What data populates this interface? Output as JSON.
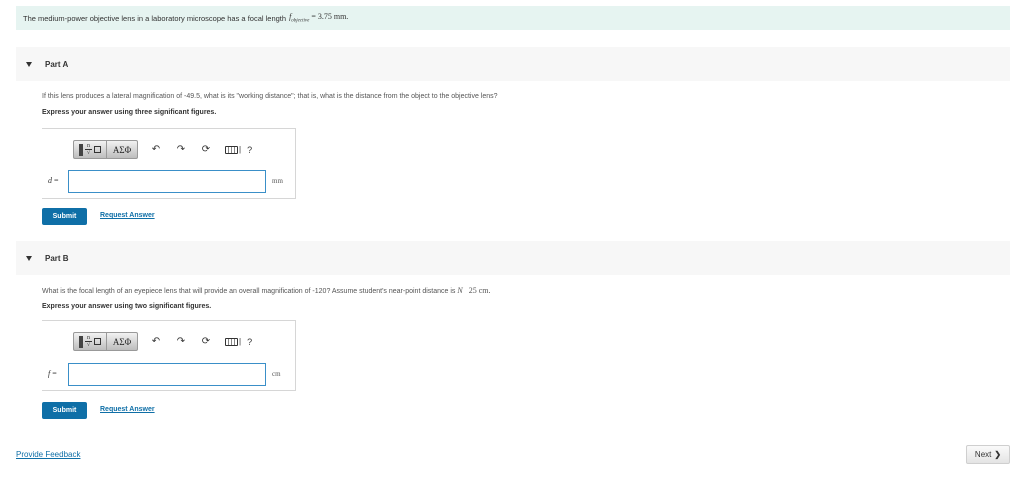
{
  "intro": {
    "text": "The medium-power objective lens in a laboratory microscope has a focal length",
    "math_var": "f",
    "math_sub": "objective",
    "math_rest": "= 3.75 mm."
  },
  "parts": [
    {
      "title": "Part A",
      "question": "If this lens produces a lateral magnification of -49.5, what is its \"working distance\"; that is, what is the distance from the object to the objective lens?",
      "instruction": "Express your answer using three significant figures.",
      "variable": "d",
      "equals": "=",
      "input_value": "",
      "unit": "mm",
      "submit_label": "Submit",
      "request_label": "Request Answer"
    },
    {
      "title": "Part B",
      "question": "What is the focal length of an eyepiece lens that will provide an overall magnification of -120? Assume student's near-point distance is",
      "question_var": "N",
      "question_value": "25 cm.",
      "instruction": "Express your answer using two significant figures.",
      "variable": "f",
      "equals": "=",
      "input_value": "",
      "unit": "cm",
      "submit_label": "Submit",
      "request_label": "Request Answer"
    }
  ],
  "toolbar": {
    "template_frac_top": "n",
    "template_frac_bottom": "√",
    "greek_label": "ΑΣΦ",
    "undo_icon": "↶",
    "redo_icon": "↷",
    "reset_icon": "⟳",
    "help_label": "?"
  },
  "footer": {
    "feedback_label": "Provide Feedback",
    "next_label": "Next",
    "next_chevron": "❯"
  },
  "colors": {
    "accent": "#0f6fa7",
    "intro_bg": "#e6f4f1",
    "input_border": "#3a8fc8"
  },
  "icons": [
    "caret-down-icon",
    "template-icon",
    "undo-icon",
    "redo-icon",
    "reset-icon",
    "keyboard-icon",
    "help-icon",
    "chevron-right-icon"
  ]
}
